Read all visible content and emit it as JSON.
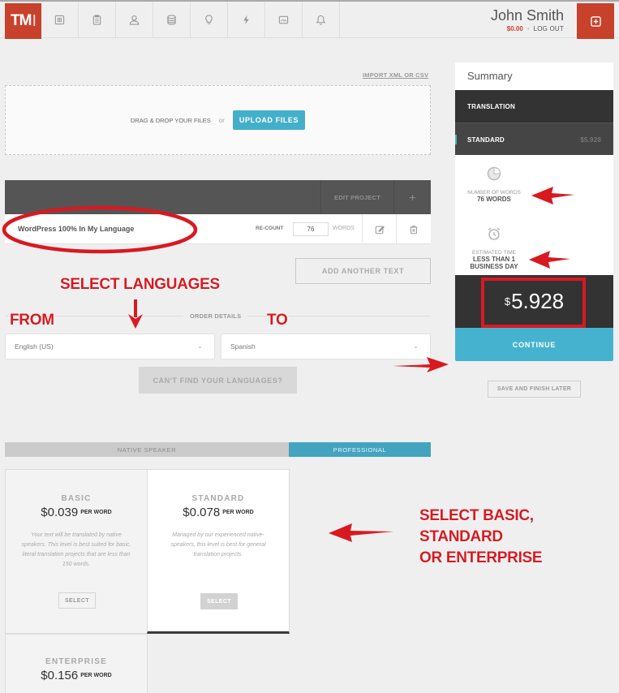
{
  "app": {
    "logo_text": "TM",
    "logo_cursor": "I"
  },
  "nav": {
    "icons": [
      "grid-icon",
      "clipboard-icon",
      "user-icon",
      "database-icon",
      "lightbulb-icon",
      "bolt-icon",
      "image-icon",
      "bell-icon"
    ]
  },
  "user": {
    "name": "John Smith",
    "balance": "$0.00",
    "separator": "•",
    "logout_label": "LOG OUT"
  },
  "upload": {
    "import_link": "IMPORT XML OR CSV",
    "drag_text": "DRAG & DROP YOUR FILES",
    "or_text": "or",
    "upload_label": "UPLOAD FILES"
  },
  "project": {
    "edit_label": "EDIT PROJECT",
    "add_symbol": "+",
    "name": "WordPress 100% In My Language",
    "recount_label": "RE-COUNT",
    "word_count": "76",
    "words_label": "WORDS"
  },
  "add_text_label": "ADD ANOTHER TEXT",
  "order": {
    "section_label": "ORDER DETAILS",
    "from_language": "English (US)",
    "to_language": "Spanish",
    "cant_find_label": "CAN'T FIND YOUR LANGUAGES?"
  },
  "tabs": {
    "native": "NATIVE SPEAKER",
    "professional": "PROFESSIONAL",
    "active": "professional"
  },
  "tiers": [
    {
      "name": "BASIC",
      "price": "$0.039",
      "unit": "PER WORD",
      "description": "Your text will be translated by native speakers. This level is best suited for basic, literal translation projects that are less than 150 words.",
      "select_label": "SELECT"
    },
    {
      "name": "STANDARD",
      "price": "$0.078",
      "unit": "PER WORD",
      "description": "Managed by our experienced native-speakers, this level is best for general translation projects.",
      "select_label": "SELECT",
      "selected": true
    },
    {
      "name": "ENTERPRISE",
      "price": "$0.156",
      "unit": "PER WORD"
    }
  ],
  "summary": {
    "title": "Summary",
    "section": "TRANSLATION",
    "level": "STANDARD",
    "level_price": "$5.928",
    "words_label": "NUMBER OF WORDS",
    "words_value": "76 WORDS",
    "time_label": "ESTIMATED TIME",
    "time_value_line1": "LESS THAN 1",
    "time_value_line2": "BUSINESS DAY",
    "total_currency": "$",
    "total_amount": "5.928",
    "continue_label": "CONTINUE",
    "save_label": "SAVE AND FINISH LATER"
  },
  "annotations": {
    "select_languages": "SELECT LANGUAGES",
    "from": "FROM",
    "to": "TO",
    "tiers_line1": "SELECT BASIC,",
    "tiers_line2": "STANDARD",
    "tiers_line3": "OR ENTERPRISE",
    "color": "#d81920"
  },
  "colors": {
    "brand_red": "#c8412b",
    "accent_blue": "#45b3cf",
    "dark": "#333333"
  }
}
